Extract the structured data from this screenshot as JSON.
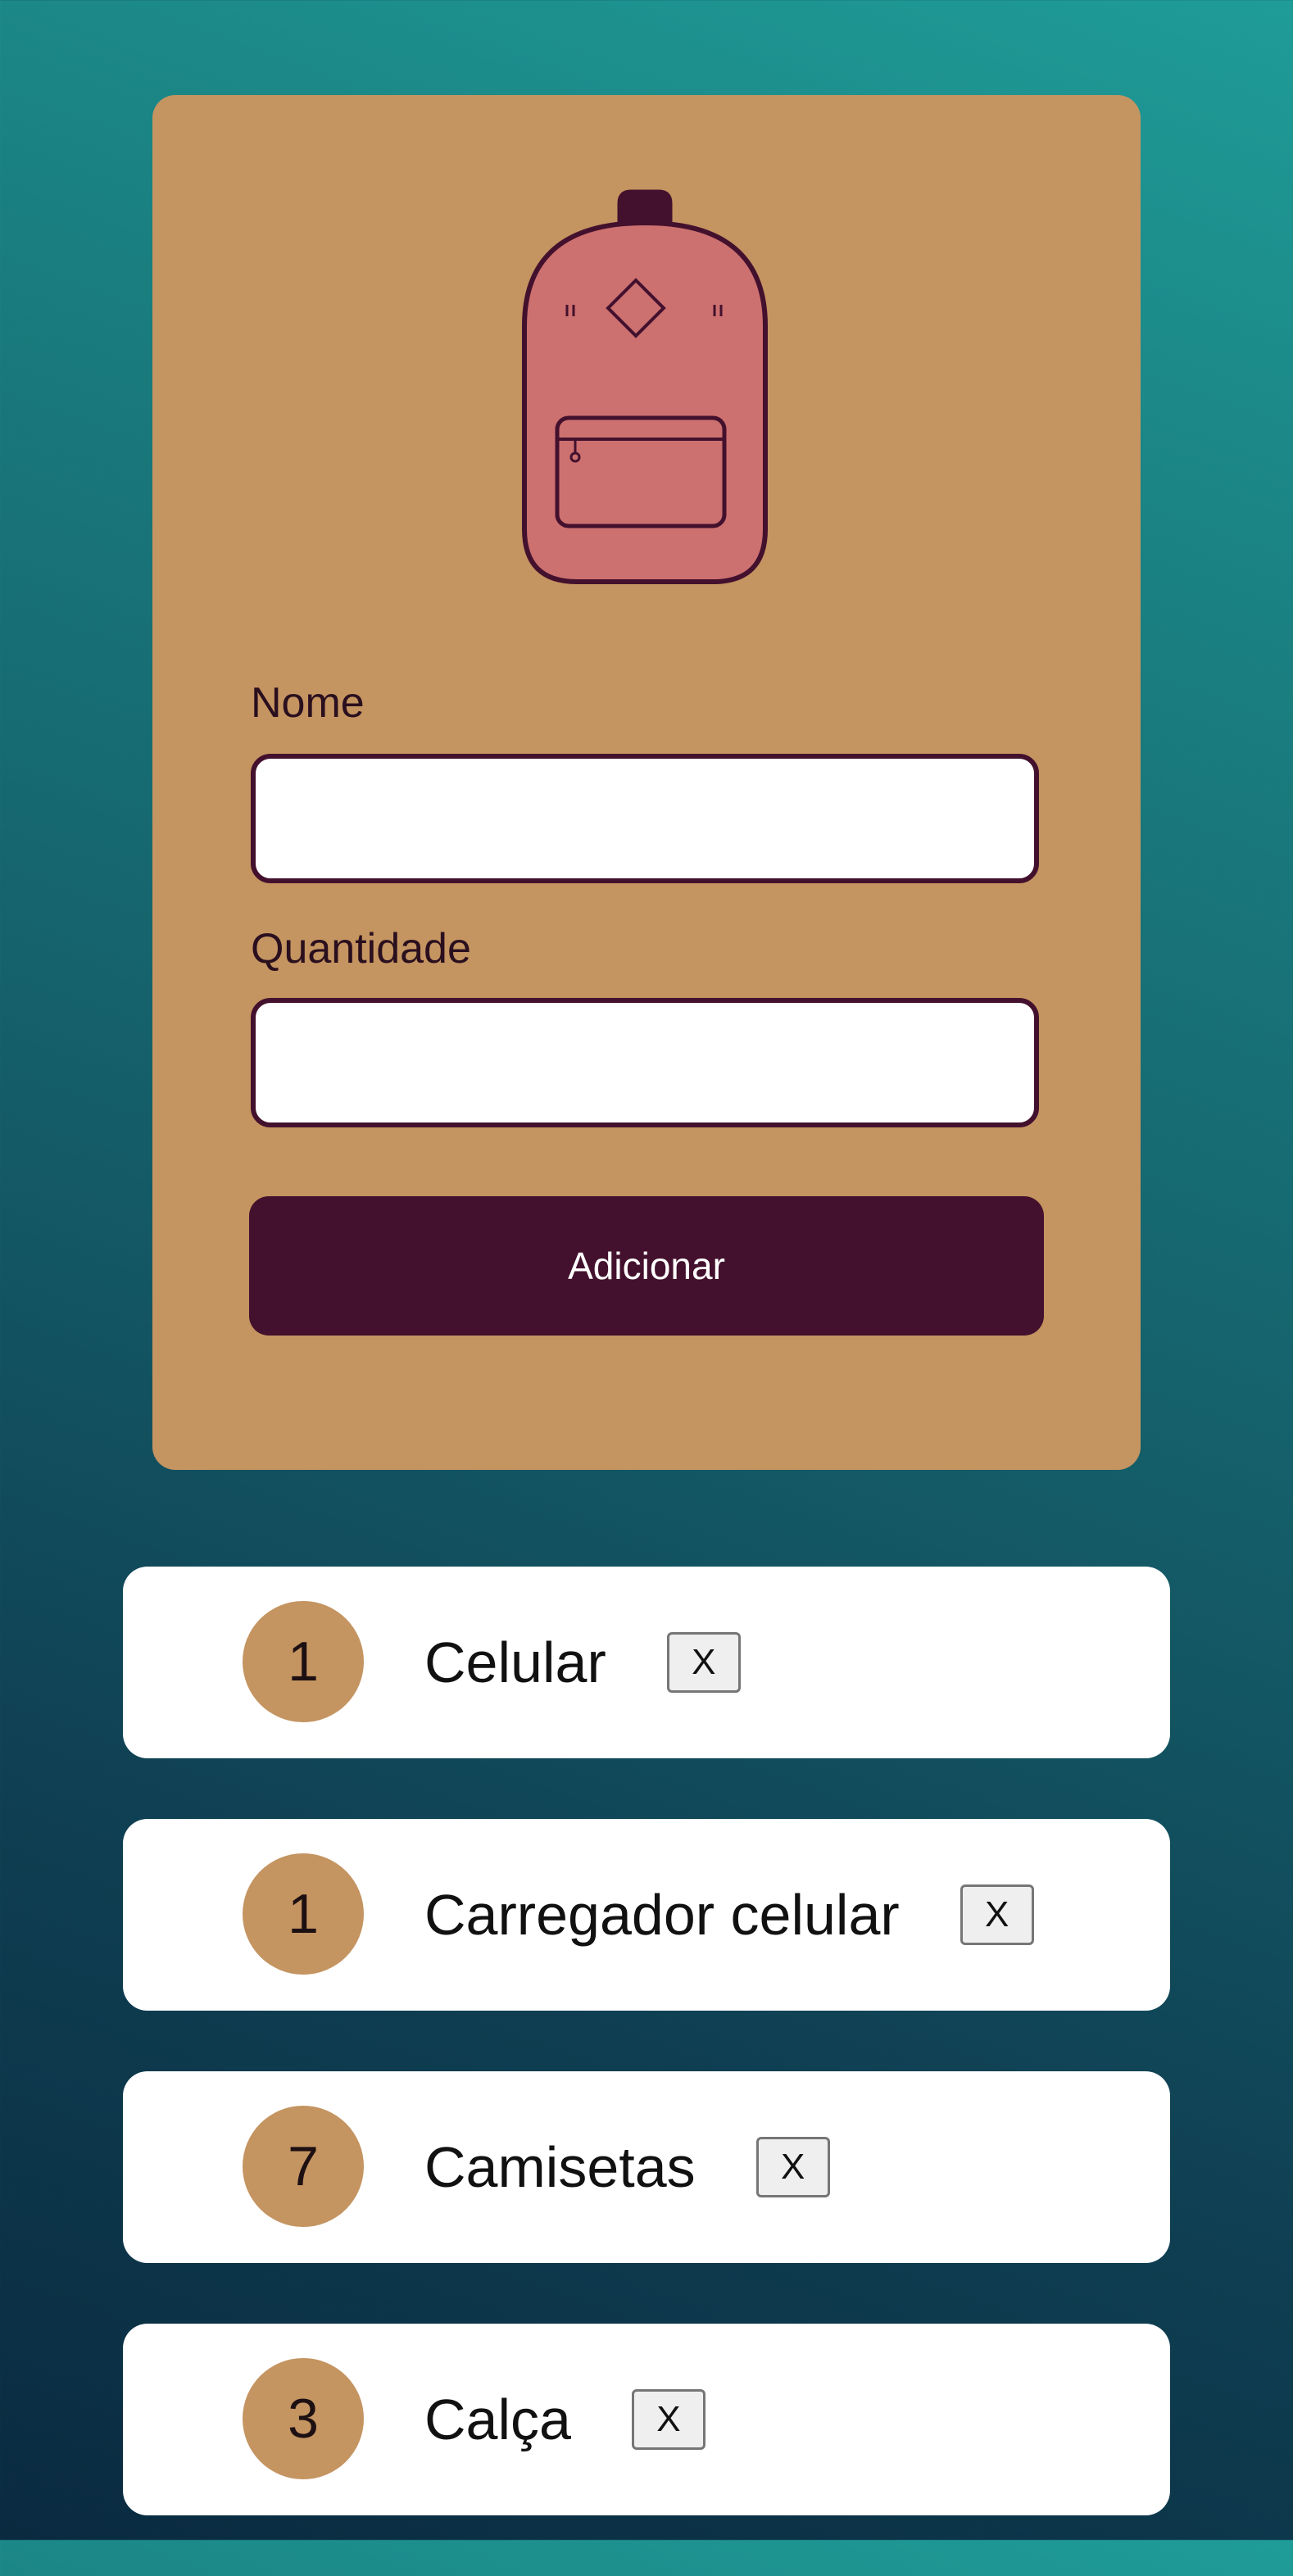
{
  "form": {
    "name_label": "Nome",
    "name_value": "",
    "quantity_label": "Quantidade",
    "quantity_value": "",
    "submit_label": "Adicionar"
  },
  "items": [
    {
      "quantity": "1",
      "name": "Celular",
      "remove_label": "X"
    },
    {
      "quantity": "1",
      "name": "Carregador celular",
      "remove_label": "X"
    },
    {
      "quantity": "7",
      "name": "Camisetas",
      "remove_label": "X"
    },
    {
      "quantity": "3",
      "name": "Calça",
      "remove_label": "X"
    }
  ],
  "colors": {
    "card": "#c49461",
    "accent": "#43112d",
    "backpack": "#cc7070",
    "background_top": "#1f9c98",
    "background_bottom": "#0a2a40"
  },
  "icons": {
    "logo": "backpack-icon"
  }
}
